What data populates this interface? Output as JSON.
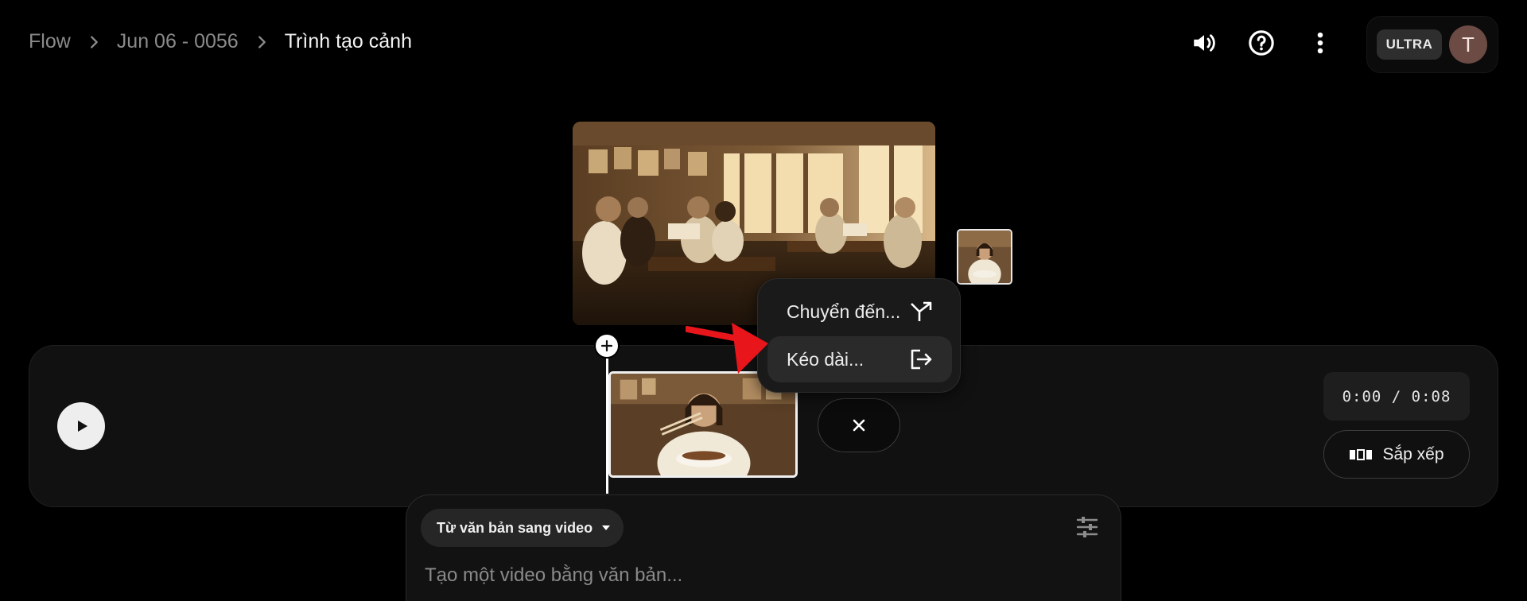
{
  "header": {
    "breadcrumb": [
      "Flow",
      "Jun 06 - 0056",
      "Trình tạo cảnh"
    ],
    "icons": [
      "volume-icon",
      "help-icon",
      "more-vert-icon"
    ],
    "plan_badge": "ULTRA",
    "avatar_letter": "T"
  },
  "timeline": {
    "time_display": "0:00 / 0:08",
    "arrange_label": "Sắp xếp"
  },
  "context_menu": {
    "items": [
      {
        "label": "Chuyển đến...",
        "icon": "transition-icon"
      },
      {
        "label": "Kéo dài...",
        "icon": "extend-icon"
      }
    ]
  },
  "composer": {
    "mode_label": "Từ văn bản sang video",
    "prompt_placeholder": "Tạo một video bằng văn bản..."
  },
  "colors": {
    "background": "#000000",
    "panel": "#111111",
    "menu": "#1a1a1a",
    "annotation_arrow": "#e8151b",
    "avatar": "#6b4b43"
  }
}
